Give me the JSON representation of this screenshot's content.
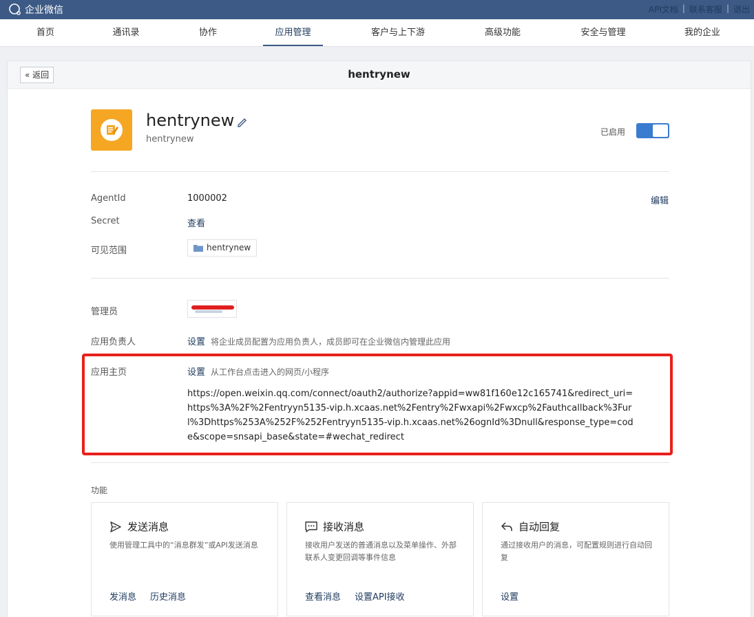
{
  "topbar": {
    "logo_text": "企业微信",
    "links": [
      "API文档",
      "联系客服",
      "退出"
    ]
  },
  "nav": {
    "items": [
      "首页",
      "通讯录",
      "协作",
      "应用管理",
      "客户与上下游",
      "高级功能",
      "安全与管理",
      "我的企业"
    ],
    "active": "应用管理"
  },
  "header": {
    "back_label": "返回",
    "title": "hentrynew"
  },
  "app": {
    "name": "hentrynew",
    "subtitle": "hentrynew",
    "status_label": "已启用",
    "enabled": true,
    "icon_color": "#f5a623"
  },
  "details": {
    "agentid_label": "AgentId",
    "agentid_value": "1000002",
    "edit_label": "编辑",
    "secret_label": "Secret",
    "secret_action": "查看",
    "scope_label": "可见范围",
    "scope_value": "hentrynew"
  },
  "management": {
    "admin_label": "管理员",
    "owner_label": "应用负责人",
    "owner_action": "设置",
    "owner_desc": "将企业成员配置为应用负责人，成员即可在企业微信内管理此应用",
    "home_label": "应用主页",
    "home_action": "设置",
    "home_desc": "从工作台点击进入的网页/小程序",
    "home_url": "https://open.weixin.qq.com/connect/oauth2/authorize?appid=ww81f160e12c165741&redirect_uri=https%3A%2F%2Fentryyn5135-vip.h.xcaas.net%2Fentry%2Fwxapi%2Fwxcp%2Fauthcallback%3Furl%3Dhttps%253A%252F%252Fentryyn5135-vip.h.xcaas.net%26ognId%3Dnull&response_type=code&scope=snsapi_base&state=#wechat_redirect"
  },
  "functions": {
    "section_label": "功能",
    "cards": [
      {
        "title": "发送消息",
        "icon": "send-icon",
        "desc": "使用管理工具中的“消息群发”或API发送消息",
        "links": [
          "发消息",
          "历史消息"
        ]
      },
      {
        "title": "接收消息",
        "icon": "message-icon",
        "desc": "接收用户发送的普通消息以及菜单操作、外部联系人变更回调等事件信息",
        "links": [
          "查看消息",
          "设置API接收"
        ]
      },
      {
        "title": "自动回复",
        "icon": "reply-icon",
        "desc": "通过接收用户的消息，可配置规则进行自动回复",
        "links": [
          "设置"
        ]
      }
    ]
  },
  "colors": {
    "topbar": "#3c5a85",
    "accent": "#3a7ccf",
    "highlight": "#e8201b"
  }
}
